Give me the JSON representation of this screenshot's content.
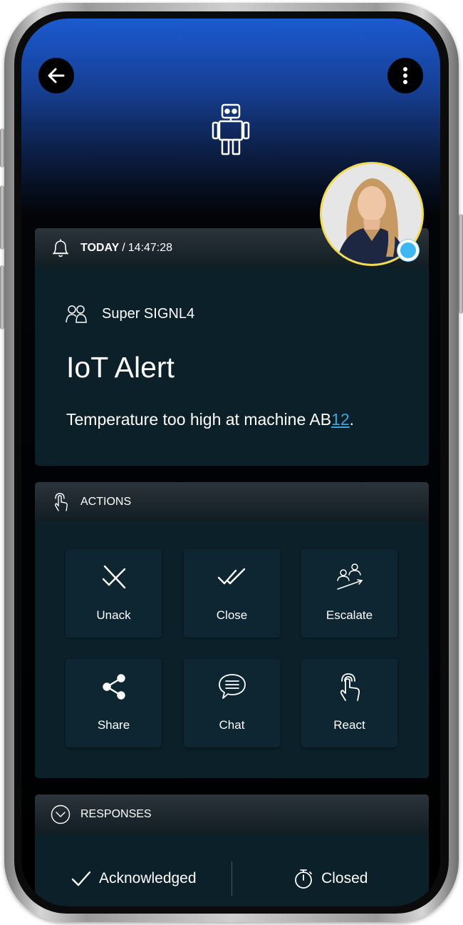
{
  "header": {
    "back_icon": "arrow-left-icon",
    "menu_icon": "more-vertical-icon",
    "alert_source_icon": "robot-icon"
  },
  "avatar": {
    "status_color": "#3fb7f2",
    "ring_color": "#f2dc52"
  },
  "alert": {
    "day": "TODAY",
    "separator": "/",
    "time": "14:47:28",
    "team": "Super SIGNL4",
    "title": "IoT Alert",
    "text_prefix": "Temperature too high at machine AB",
    "text_link": "12",
    "text_suffix": "."
  },
  "actions": {
    "title": "ACTIONS",
    "items": [
      {
        "label": "Unack",
        "icon": "unack-icon"
      },
      {
        "label": "Close",
        "icon": "double-check-icon"
      },
      {
        "label": "Escalate",
        "icon": "escalate-icon"
      },
      {
        "label": "Share",
        "icon": "share-icon"
      },
      {
        "label": "Chat",
        "icon": "chat-icon"
      },
      {
        "label": "React",
        "icon": "touch-icon"
      }
    ]
  },
  "responses": {
    "title": "RESPONSES",
    "items": [
      {
        "label": "Acknowledged",
        "icon": "check-icon"
      },
      {
        "label": "Closed",
        "icon": "stopwatch-icon"
      }
    ]
  },
  "colors": {
    "header_gradient_top": "#1b5ad0",
    "card_background": "#0c202a",
    "link": "#3ea3dd"
  }
}
